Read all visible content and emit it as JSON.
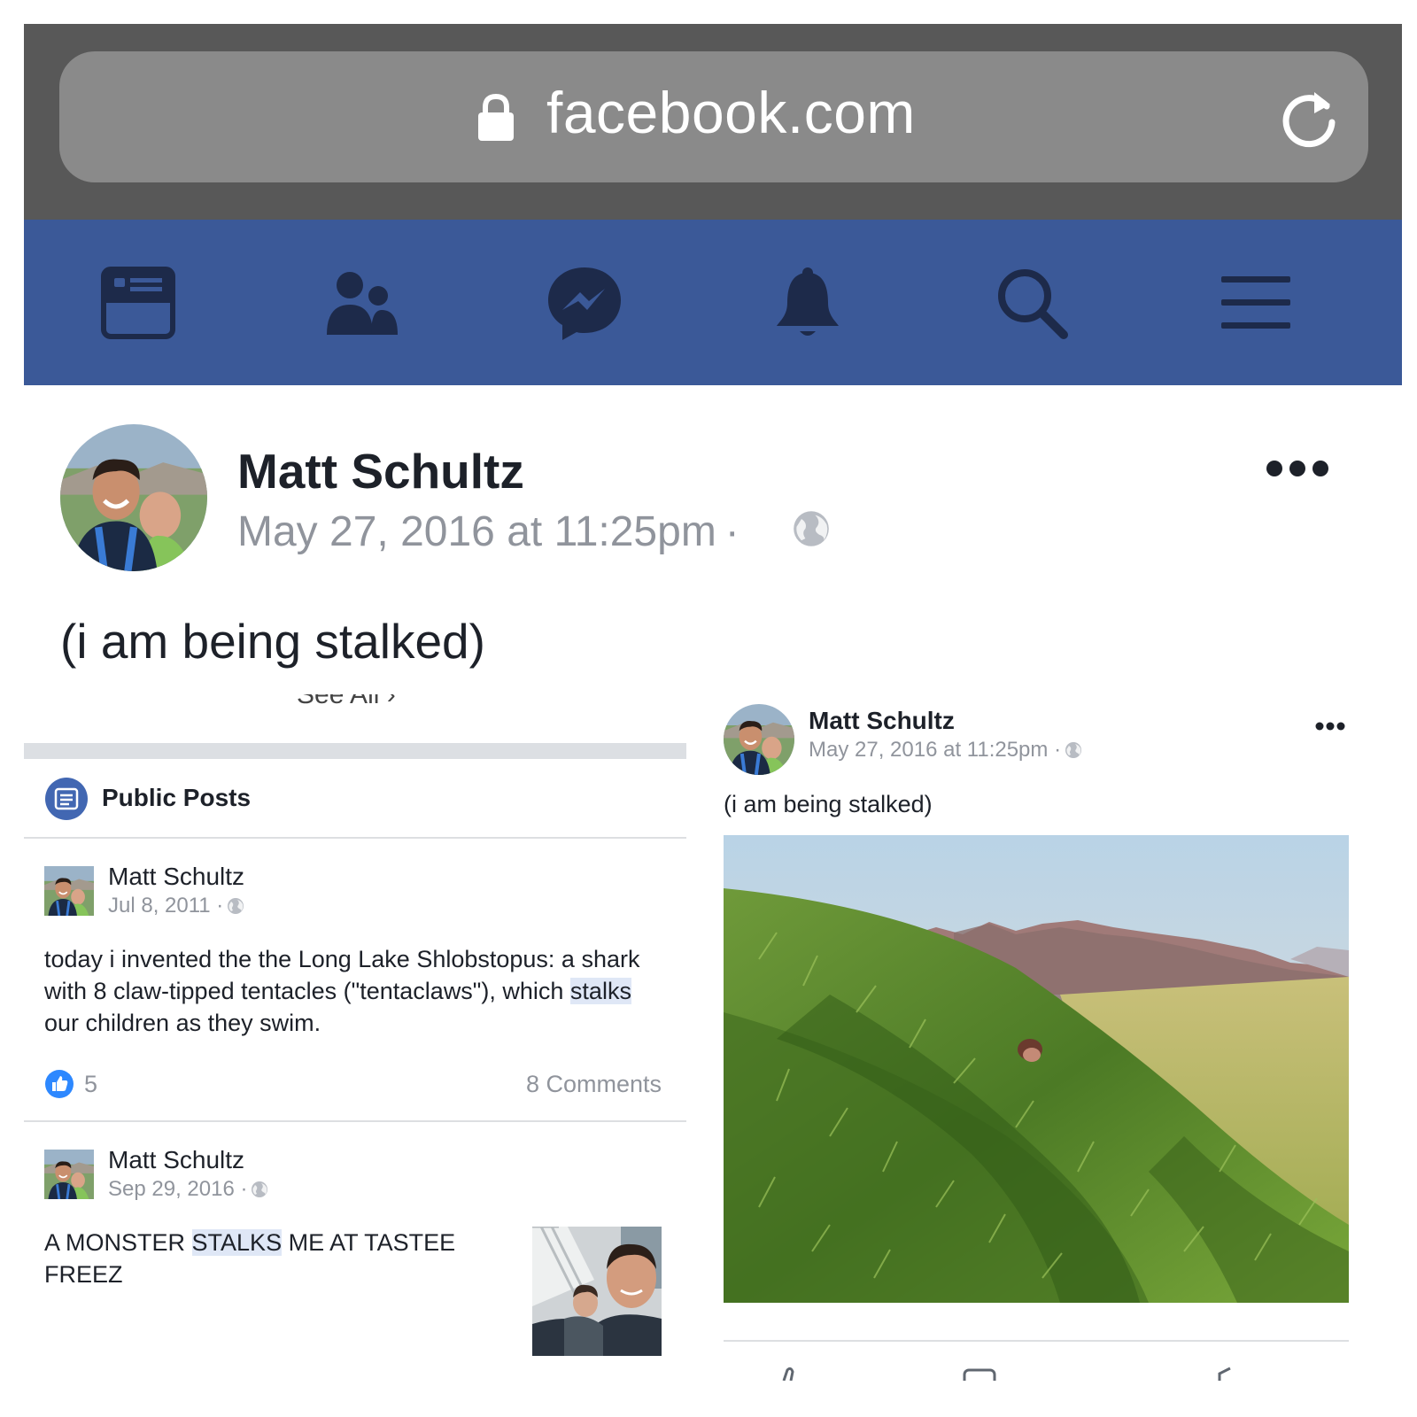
{
  "browser": {
    "url": "facebook.com"
  },
  "nav": {
    "icons": [
      "news-feed-icon",
      "friends-icon",
      "messenger-icon",
      "notifications-icon",
      "search-icon",
      "menu-icon"
    ]
  },
  "post": {
    "author": "Matt Schultz",
    "timestamp": "May 27, 2016 at 11:25pm",
    "separator": "·",
    "status": "(i am being stalked)"
  },
  "left_panel": {
    "see_all": "See All",
    "section_title": "Public Posts",
    "posts": [
      {
        "author": "Matt Schultz",
        "date": "Jul 8, 2011 ·",
        "text_before": "today i invented the the Long Lake Shlobstopus: a shark with 8 claw-tipped tentacles (\"tentaclaws\"), which ",
        "text_highlight": "stalks",
        "text_after": " our children as they swim.",
        "likes": "5",
        "comments": "8 Comments"
      },
      {
        "author": "Matt Schultz",
        "date": "Sep 29, 2016 ·",
        "text_before": "A MONSTER ",
        "text_highlight": "STALKS",
        "text_after": " ME AT TASTEE FREEZ"
      }
    ]
  },
  "right_panel": {
    "author": "Matt Schultz",
    "timestamp": "May 27, 2016 at 11:25pm ·",
    "status": "(i am being stalked)"
  },
  "colors": {
    "fb_blue": "#3b5998",
    "nav_icon": "#1d2a4a",
    "chrome": "#585858",
    "url_bar": "#8a8a8a",
    "highlight": "#dfe7f6",
    "like_blue": "#2d88ff"
  }
}
